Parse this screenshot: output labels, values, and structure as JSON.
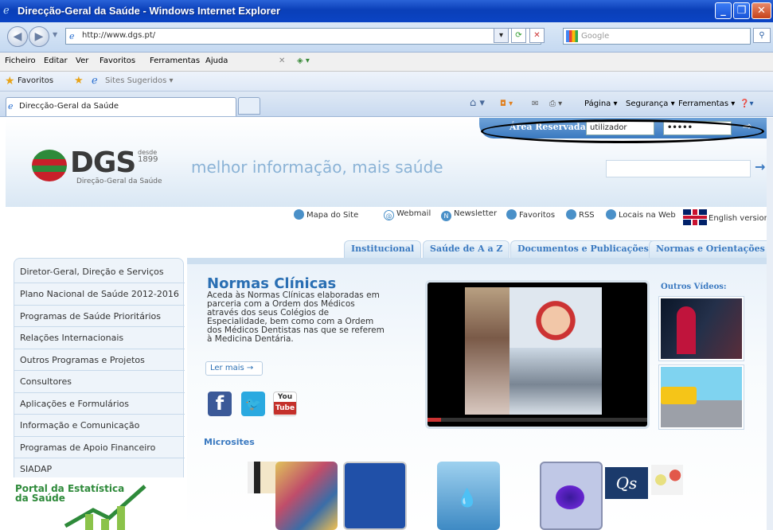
{
  "window": {
    "title": "Direcção-Geral da Saúde - Windows Internet Explorer"
  },
  "addressbar": {
    "url": "http://www.dgs.pt/",
    "search_placeholder": "Google"
  },
  "menu": [
    "Ficheiro",
    "Editar",
    "Ver",
    "Favoritos",
    "Ferramentas",
    "Ajuda"
  ],
  "favorites": {
    "label": "Favoritos",
    "suggested": "Sites Sugeridos"
  },
  "tabs": [
    {
      "label": "Direcção-Geral da Saúde"
    }
  ],
  "commandbar": {
    "page": "Página",
    "security": "Segurança",
    "tools": "Ferramentas"
  },
  "site": {
    "reserved_label": "Área Reservada:",
    "username": "utilizador",
    "password": "•••••",
    "logo_text": "DGS",
    "logo_since": "desde",
    "logo_year": "1899",
    "logo_sub": "Direção-Geral da Saúde",
    "slogan": "melhor informação, mais saúde",
    "quicklinks": [
      "Mapa do Site",
      "Webmail",
      "Newsletter",
      "Favoritos",
      "RSS",
      "Locais na Web",
      "English version"
    ],
    "navtabs": [
      "Institucional",
      "Saúde de A a Z",
      "Documentos e Publicações",
      "Normas e Orientações"
    ],
    "sidebar": [
      "Diretor-Geral, Direção e Serviços",
      "Plano Nacional de Saúde 2012-2016",
      "Programas de Saúde Prioritários",
      "Relações Internacionais",
      "Outros Programas e Projetos",
      "Consultores",
      "Aplicações e Formulários",
      "Informação e Comunicação",
      "Programas de Apoio Financeiro",
      "SIADAP"
    ],
    "portal": {
      "line1": "Portal da Estatística",
      "line2": "da Saúde"
    },
    "feature": {
      "title": "Normas Clínicas",
      "text": "Aceda às Normas Clínicas elaboradas em parceria com a Ordem dos Médicos através dos seus Colégios de Especialidade, bem como com a Ordem dos Médicos Dentistas nas que se referem à Medicina Dentária.",
      "more": "Ler mais →"
    },
    "social": {
      "youtube_1": "You",
      "youtube_2": "Tube"
    },
    "other_videos": "Outros Vídeos:",
    "microsites": "Microsites"
  }
}
